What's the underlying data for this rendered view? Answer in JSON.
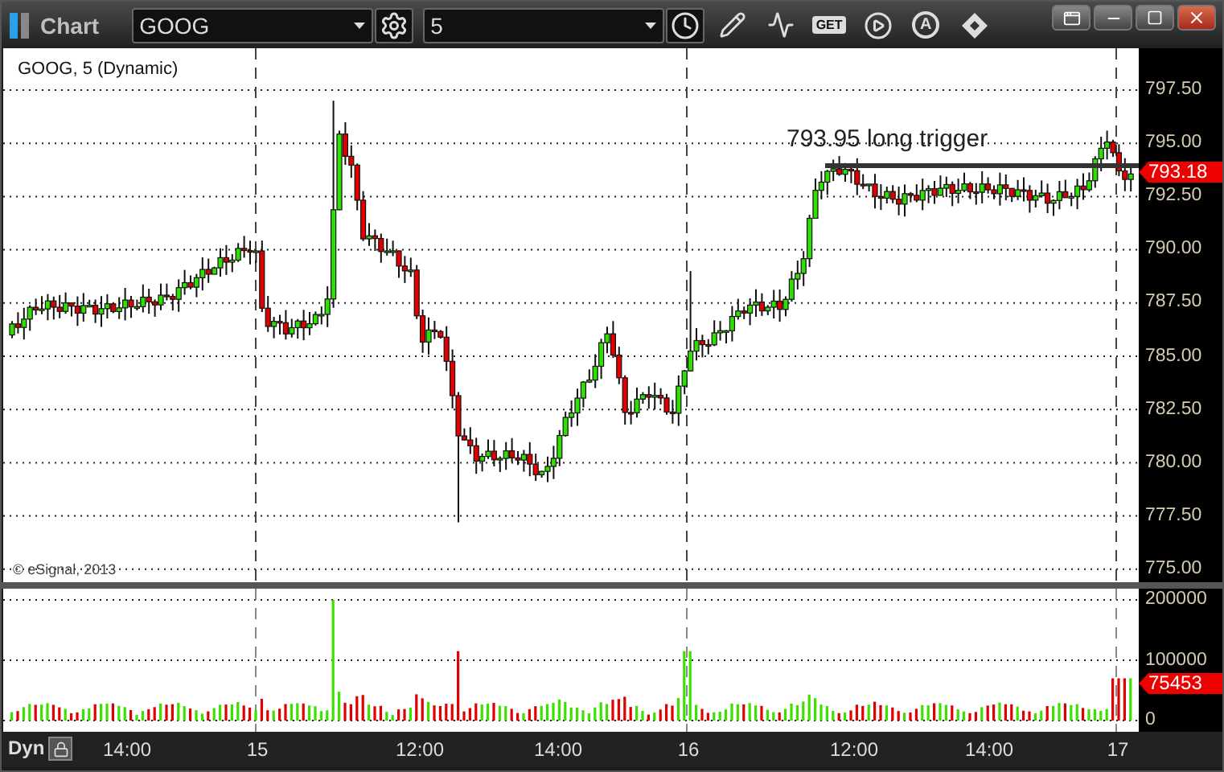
{
  "window": {
    "title": "Chart"
  },
  "toolbar": {
    "symbol": "GOOG",
    "interval": "5",
    "get_label": "GET",
    "auto_label": "A"
  },
  "chart": {
    "legend": "GOOG, 5 (Dynamic)",
    "copyright": "© eSignal, 2013",
    "annotation": "793.95 long trigger",
    "last_price": "793.18",
    "price_ticks": [
      "797.50",
      "795.00",
      "792.50",
      "790.00",
      "787.50",
      "785.00",
      "782.50",
      "780.00",
      "777.50",
      "775.00"
    ]
  },
  "volume": {
    "ticks": [
      "200000",
      "100000",
      "0"
    ],
    "last_volume": "75453"
  },
  "time_axis": {
    "mode": "Dyn",
    "labels": [
      "14:00",
      "15",
      "12:00",
      "14:00",
      "16",
      "12:00",
      "14:00",
      "17"
    ]
  }
}
